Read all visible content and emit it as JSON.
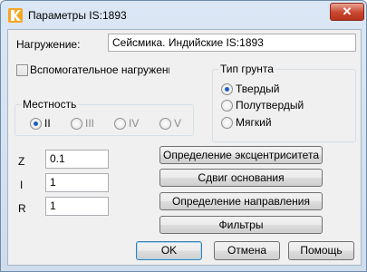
{
  "window": {
    "title": "Параметры IS:1893",
    "close_glyph": "✕"
  },
  "load": {
    "label": "Нагружение:",
    "value": "Сейсмика. Индийские IS:1893"
  },
  "auxiliary_load": {
    "label": "Вспомогательное нагружение",
    "checked": false
  },
  "terrain": {
    "title": "Местность",
    "options": [
      {
        "label": "II",
        "selected": true
      },
      {
        "label": "III",
        "selected": false
      },
      {
        "label": "IV",
        "selected": false
      },
      {
        "label": "V",
        "selected": false
      }
    ]
  },
  "soil_type": {
    "title": "Тип грунта",
    "options": [
      {
        "label": "Твердый",
        "selected": true
      },
      {
        "label": "Полутвердый",
        "selected": false
      },
      {
        "label": "Мягкий",
        "selected": false
      }
    ]
  },
  "fields": {
    "z": {
      "label": "Z",
      "value": "0.1"
    },
    "i": {
      "label": "I",
      "value": "1"
    },
    "r": {
      "label": "R",
      "value": "1"
    }
  },
  "actions": {
    "eccentricity": "Определение эксцентриситета",
    "base_shift": "Сдвиг основания",
    "direction": "Определение направления",
    "filters": "Фильтры"
  },
  "footer": {
    "ok": "OK",
    "cancel": "Отмена",
    "help": "Помощь"
  }
}
